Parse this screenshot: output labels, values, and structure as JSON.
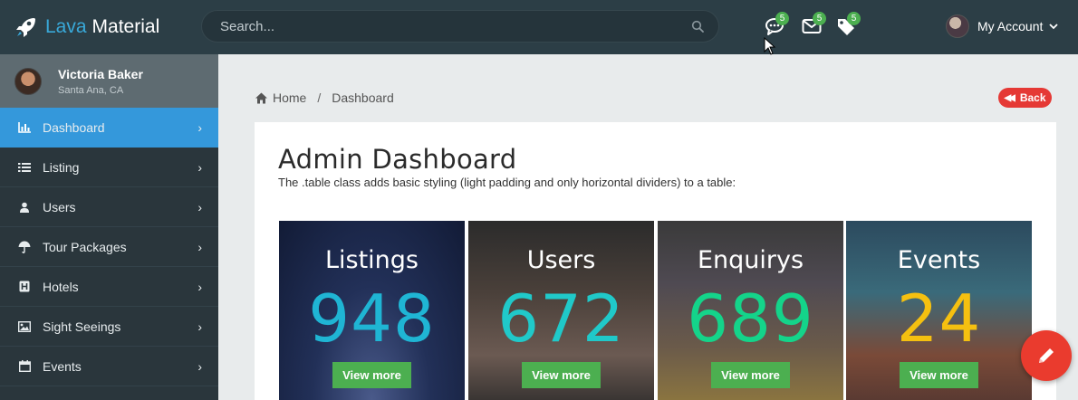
{
  "brand": {
    "part1": "Lava",
    "part2": "Material",
    "icon": "rocket-icon"
  },
  "search": {
    "placeholder": "Search..."
  },
  "notifications": [
    {
      "name": "chat-icon",
      "count": "5"
    },
    {
      "name": "mail-icon",
      "count": "5"
    },
    {
      "name": "tags-icon",
      "count": "5"
    }
  ],
  "account": {
    "label": "My Account"
  },
  "user": {
    "name": "Victoria Baker",
    "location": "Santa Ana, CA"
  },
  "sidebar": {
    "items": [
      {
        "label": "Dashboard",
        "icon": "bar-chart-icon",
        "active": true
      },
      {
        "label": "Listing",
        "icon": "list-icon"
      },
      {
        "label": "Users",
        "icon": "user-icon"
      },
      {
        "label": "Tour Packages",
        "icon": "umbrella-icon"
      },
      {
        "label": "Hotels",
        "icon": "hotel-icon"
      },
      {
        "label": "Sight Seeings",
        "icon": "image-icon"
      },
      {
        "label": "Events",
        "icon": "calendar-icon"
      }
    ]
  },
  "breadcrumb": {
    "home": "Home",
    "separator": "/",
    "current": "Dashboard"
  },
  "back": {
    "label": "Back"
  },
  "page": {
    "title": "Admin Dashboard",
    "subtitle": "The .table class adds basic styling (light padding and only horizontal dividers) to a table:"
  },
  "cards": [
    {
      "title": "Listings",
      "value": "948",
      "button": "View more",
      "color": "#1fb5d4"
    },
    {
      "title": "Users",
      "value": "672",
      "button": "View more",
      "color": "#20c9c9"
    },
    {
      "title": "Enquirys",
      "value": "689",
      "button": "View more",
      "color": "#14d48a"
    },
    {
      "title": "Events",
      "value": "24",
      "button": "View more",
      "color": "#f5c010"
    }
  ],
  "colors": {
    "topbar": "#2c3e46",
    "sidebar": "#2a363c",
    "active": "#3498db",
    "accent": "#e53935",
    "green": "#4caf50"
  }
}
